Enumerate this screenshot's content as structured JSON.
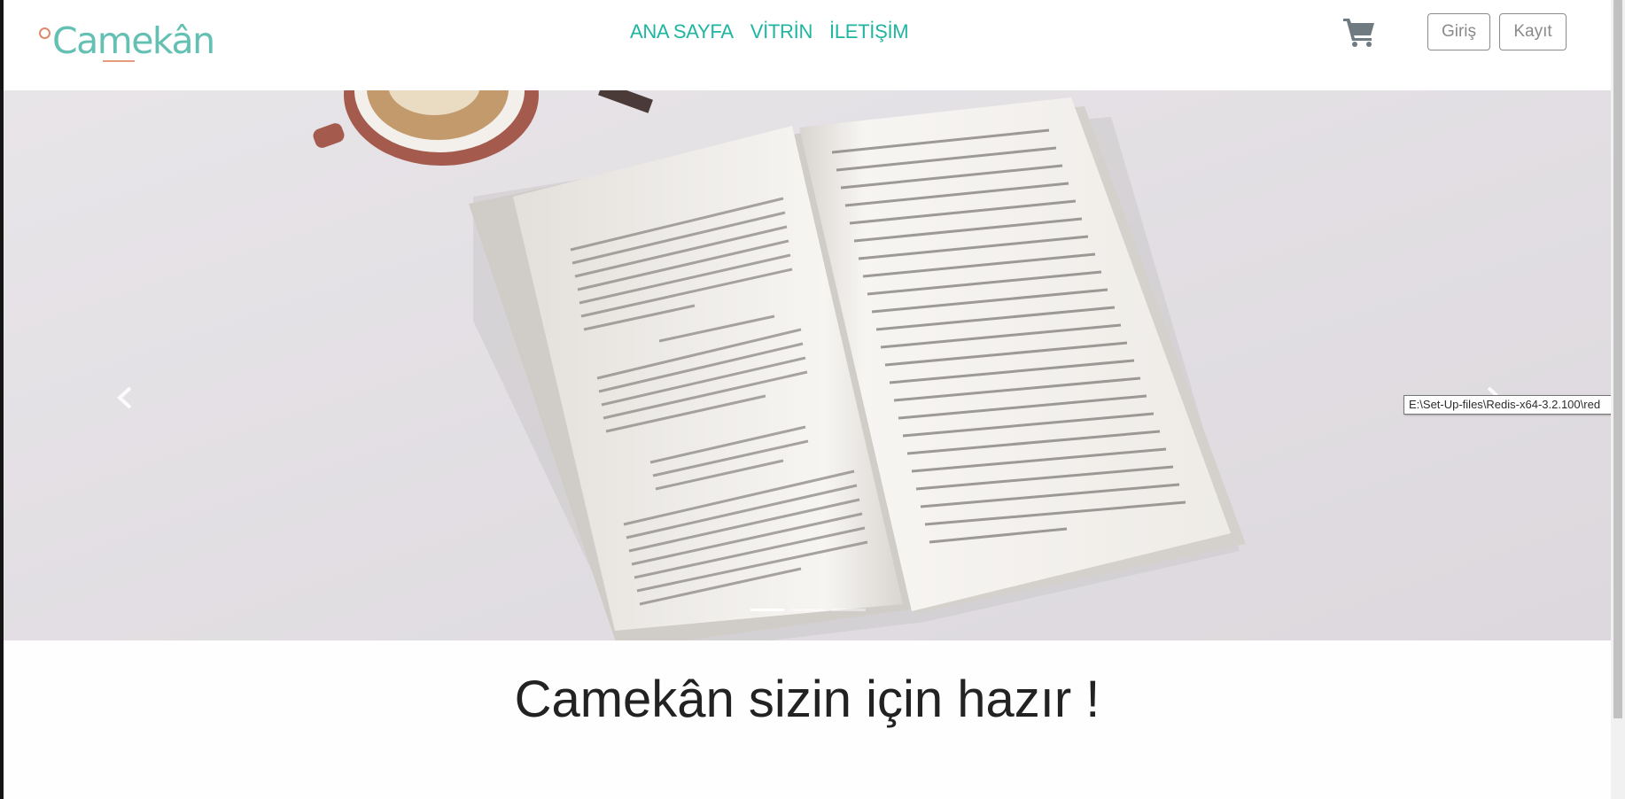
{
  "brand": {
    "logo_text": "Camekân"
  },
  "nav": {
    "items": [
      {
        "label": "ANA SAYFA"
      },
      {
        "label": "VİTRİN"
      },
      {
        "label": "İLETİŞİM"
      }
    ]
  },
  "header": {
    "cart_icon": "shopping-cart-icon",
    "login_label": "Giriş",
    "register_label": "Kayıt"
  },
  "carousel": {
    "prev_icon": "chevron-left-icon",
    "next_icon": "chevron-right-icon",
    "slide_count": 3,
    "active_index": 0,
    "image": "open-book-and-coffee-photo"
  },
  "tooltip": {
    "text": "E:\\Set-Up-files\\Redis-x64-3.2.100\\red"
  },
  "hero": {
    "headline": "Camekân sizin için hazır !"
  },
  "colors": {
    "accent": "#1fb5a0",
    "logo": "#63c0b3",
    "logo_accent": "#e59b7c",
    "button_border": "#8b8b8b",
    "headline": "#222222"
  }
}
